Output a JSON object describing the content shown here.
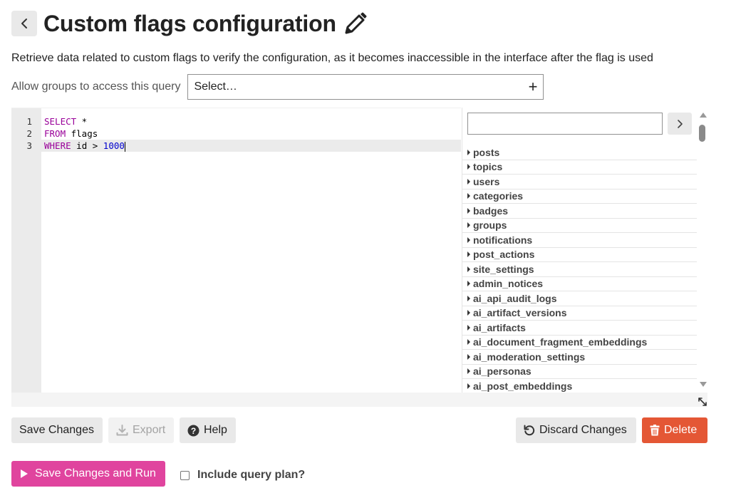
{
  "header": {
    "title": "Custom flags configuration"
  },
  "description": "Retrieve data related to custom flags to verify the configuration, as it becomes inaccessible in the interface after the flag is used",
  "groups": {
    "label": "Allow groups to access this query",
    "placeholder": "Select…",
    "add_icon": "plus-icon"
  },
  "editor": {
    "lines": [
      {
        "num": "1",
        "keyword": "SELECT",
        "rest": " *",
        "number": ""
      },
      {
        "num": "2",
        "keyword": "FROM",
        "rest": " flags",
        "number": ""
      },
      {
        "num": "3",
        "keyword": "WHERE",
        "rest": " id > ",
        "number": "1000"
      }
    ],
    "active_line": 3
  },
  "schema": {
    "filter_value": "",
    "items": [
      "posts",
      "topics",
      "users",
      "categories",
      "badges",
      "groups",
      "notifications",
      "post_actions",
      "site_settings",
      "admin_notices",
      "ai_api_audit_logs",
      "ai_artifact_versions",
      "ai_artifacts",
      "ai_document_fragment_embeddings",
      "ai_moderation_settings",
      "ai_personas",
      "ai_post_embeddings"
    ]
  },
  "actions": {
    "save": "Save Changes",
    "export": "Export",
    "help": "Help",
    "discard": "Discard Changes",
    "delete": "Delete",
    "save_and_run": "Save Changes and Run",
    "include_plan": "Include query plan?"
  },
  "colors": {
    "danger": "#e45735",
    "run": "#e0449e",
    "keyword": "#990099",
    "number": "#0000cd"
  }
}
